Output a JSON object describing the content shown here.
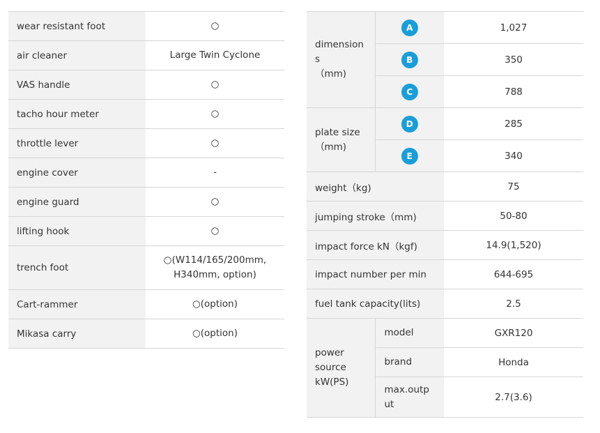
{
  "left_table": [
    {
      "label": "wear resistant foot",
      "value": "○"
    },
    {
      "label": "air cleaner",
      "value": "Large Twin Cyclone"
    },
    {
      "label": "VAS handle",
      "value": "○"
    },
    {
      "label": "tacho hour meter",
      "value": "○"
    },
    {
      "label": "throttle lever",
      "value": "○"
    },
    {
      "label": "engine cover",
      "value": "-"
    },
    {
      "label": "engine guard",
      "value": "○"
    },
    {
      "label": "lifting hook",
      "value": "○"
    },
    {
      "label": "trench foot",
      "value_line1": "○(W114/165/200mm,",
      "value_line2": "H340mm, option)"
    },
    {
      "label": "Cart-rammer",
      "value": "○(option)"
    },
    {
      "label": "Mikasa carry",
      "value": "○(option)"
    }
  ],
  "right_table": {
    "dimensions": {
      "label_line1": "dimension",
      "label_line2": "s",
      "label_line3": "（mm)",
      "rows": [
        {
          "badge": "A",
          "value": "1,027"
        },
        {
          "badge": "B",
          "value": "350"
        },
        {
          "badge": "C",
          "value": "788"
        }
      ]
    },
    "plate_size": {
      "label_line1": "plate size",
      "label_line2": "（mm)",
      "rows": [
        {
          "badge": "D",
          "value": "285"
        },
        {
          "badge": "E",
          "value": "340"
        }
      ]
    },
    "simple_rows": [
      {
        "label": "weight（kg)",
        "value": "75"
      },
      {
        "label": "jumping stroke（mm)",
        "value": "50-80"
      },
      {
        "label": "impact force kN（kgf)",
        "value": "14.9(1,520)"
      },
      {
        "label": "impact number per min",
        "value": "644-695"
      },
      {
        "label": "fuel tank capacity(lits)",
        "value": "2.5"
      }
    ],
    "power_source": {
      "label_line1": "power",
      "label_line2": "source",
      "label_line3": "kW(PS)",
      "rows": [
        {
          "label": "model",
          "value": "GXR120"
        },
        {
          "label": "brand",
          "value": "Honda"
        },
        {
          "label_line1": "max.outp",
          "label_line2": "ut",
          "value": "2.7(3.6)"
        }
      ]
    }
  },
  "colors": {
    "label_bg": "#f2f2f2",
    "border": "#d6d6d6",
    "badge_bg": "#1a9ed9",
    "text": "#333333"
  }
}
